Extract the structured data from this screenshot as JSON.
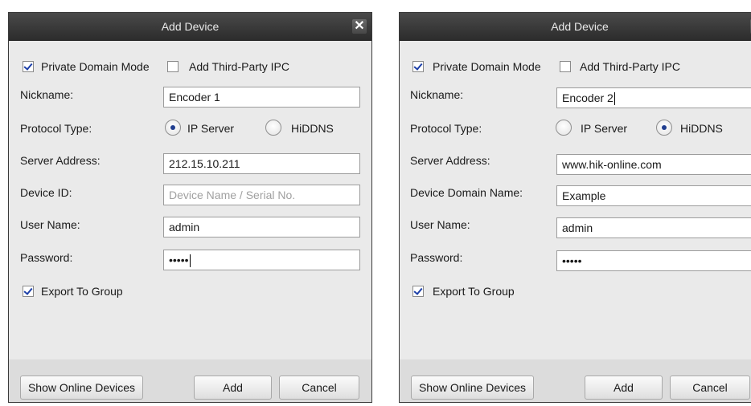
{
  "dialogs": [
    {
      "title": "Add Device",
      "close_glyph": "✕",
      "private_domain_label": "Private Domain Mode",
      "third_party_label": "Add Third-Party IPC",
      "nickname_label": "Nickname:",
      "nickname_value": "Encoder 1",
      "protocol_label": "Protocol Type:",
      "ip_server_label": "IP Server",
      "hiddns_label": "HiDDNS",
      "protocol_selected": "IP Server",
      "server_label": "Server Address:",
      "server_value": "212.15.10.211",
      "device_id_label": "Device ID:",
      "device_id_placeholder": "Device Name / Serial No.",
      "user_label": "User Name:",
      "user_value": "admin",
      "password_label": "Password:",
      "password_value": "•••••",
      "export_label": "Export To Group",
      "show_online_label": "Show Online Devices",
      "add_label": "Add",
      "cancel_label": "Cancel"
    },
    {
      "title": "Add Device",
      "close_glyph": "✕",
      "private_domain_label": "Private Domain Mode",
      "third_party_label": "Add Third-Party IPC",
      "nickname_label": "Nickname:",
      "nickname_value": "Encoder 2",
      "protocol_label": "Protocol Type:",
      "ip_server_label": "IP Server",
      "hiddns_label": "HiDDNS",
      "protocol_selected": "HiDDNS",
      "server_label": "Server Address:",
      "server_value": "www.hik-online.com",
      "domain_name_label": "Device Domain Name:",
      "domain_name_value": "Example",
      "user_label": "User Name:",
      "user_value": "admin",
      "password_label": "Password:",
      "password_value": "•••••",
      "export_label": "Export To Group",
      "show_online_label": "Show Online Devices",
      "add_label": "Add",
      "cancel_label": "Cancel"
    }
  ],
  "colors": {
    "titlebar": "#333333",
    "dialog_bg": "#eaeaea",
    "footer_bg": "#dcdcdc",
    "check_mark": "#1c3fa8",
    "radio_dot": "#1f3d8f"
  },
  "icons": {
    "close": "close-icon",
    "checkbox": "checkbox-icon",
    "radio": "radio-icon"
  }
}
